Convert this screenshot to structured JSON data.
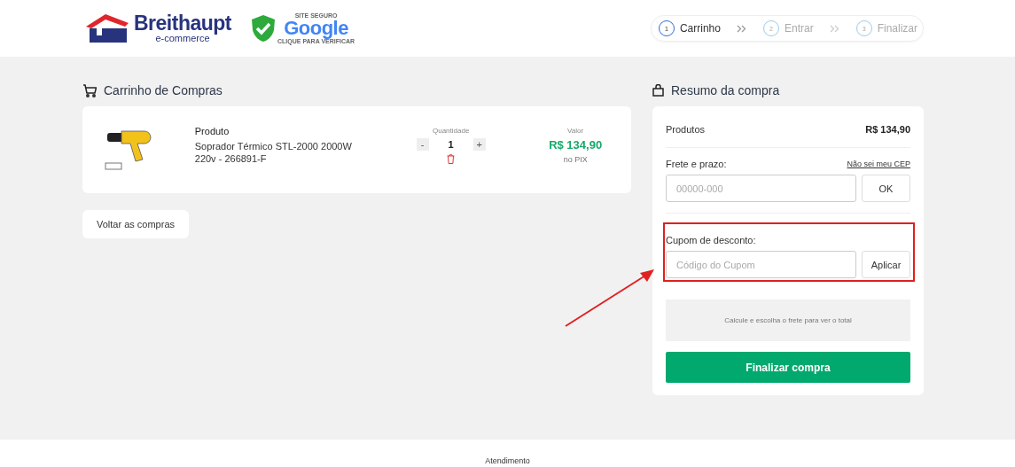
{
  "header": {
    "brand": {
      "name": "Breithaupt",
      "tagline": "e-commerce"
    },
    "badge": {
      "top": "SITE SEGURO",
      "name": "Google",
      "bottom": "CLIQUE PARA VERIFICAR"
    },
    "steps": [
      {
        "number": "1",
        "label": "Carrinho",
        "selected": true
      },
      {
        "number": "2",
        "label": "Entrar",
        "selected": false
      },
      {
        "number": "3",
        "label": "Finalizar",
        "selected": false
      }
    ]
  },
  "cart": {
    "title": "Carrinho de Compras",
    "items": [
      {
        "product_label": "Produto",
        "name": "Soprador Térmico STL-2000 2000W 220v - 266891-F",
        "quantity_label": "Quantidade",
        "decrement": "-",
        "quantity": "1",
        "increment": "+",
        "value_label": "Valor",
        "price": "R$ 134,90",
        "price_note": "no PIX"
      }
    ],
    "back_button": "Voltar as compras"
  },
  "summary": {
    "title": "Resumo da compra",
    "products_label": "Produtos",
    "products_value": "R$ 134,90",
    "shipping": {
      "label": "Frete e prazo:",
      "link": "Não sei meu CEP",
      "placeholder": "00000-000",
      "button": "OK"
    },
    "coupon": {
      "label": "Cupom de desconto:",
      "placeholder": "Código do Cupom",
      "button": "Aplicar",
      "highlighted": true
    },
    "total_note": "Calcule e escolha o frete para ver o total",
    "checkout_button": "Finalizar compra"
  },
  "footer": {
    "heading": "Atendimento"
  }
}
